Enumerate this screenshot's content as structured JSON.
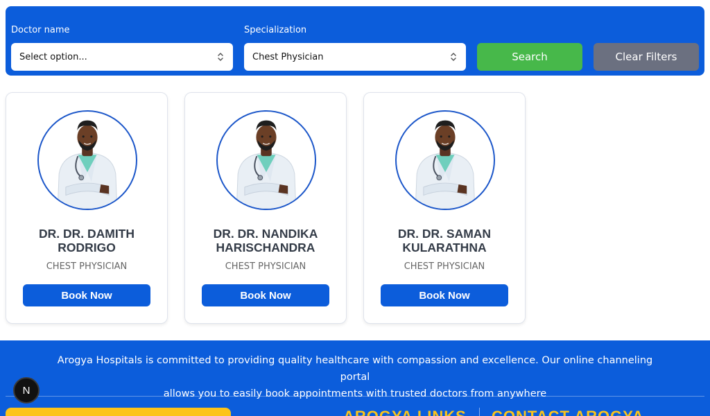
{
  "filters": {
    "doctor_label": "Doctor name",
    "doctor_value": "Select option...",
    "specialization_label": "Specialization",
    "specialization_value": "Chest Physician",
    "search_label": "Search",
    "clear_label": "Clear Filters"
  },
  "doctors": [
    {
      "name_line1": "DR. DR. DAMITH",
      "name_line2": "RODRIGO",
      "specialization": "CHEST PHYSICIAN",
      "button_label": "Book Now"
    },
    {
      "name_line1": "DR. DR. NANDIKA",
      "name_line2": "HARISCHANDRA",
      "specialization": "CHEST PHYSICIAN",
      "button_label": "Book Now"
    },
    {
      "name_line1": "DR. DR. SAMAN",
      "name_line2": "KULARATHNA",
      "specialization": "CHEST PHYSICIAN",
      "button_label": "Book Now"
    }
  ],
  "footer": {
    "about_line1": "Arogya Hospitals is committed to providing quality healthcare with compassion and excellence. Our online channeling portal",
    "about_line2": "allows you to easily book appointments with trusted doctors from anywhere",
    "links_heading": "AROGYA LINKS",
    "contact_heading": "CONTACT AROGYA"
  },
  "dev_badge": "N",
  "colors": {
    "primary": "#0c5ddb",
    "search_green": "#47b84a",
    "clear_gray": "#6b7080",
    "accent_yellow": "#fcc419"
  }
}
